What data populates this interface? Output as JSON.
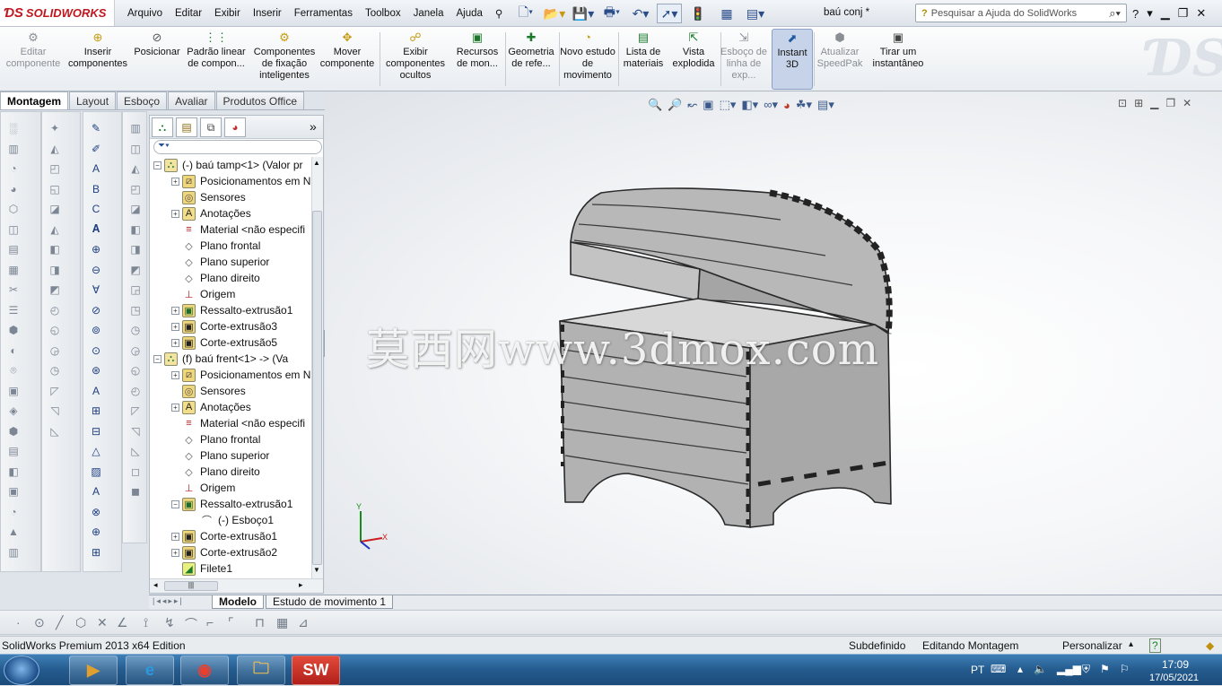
{
  "titlebar": {
    "logo": "SOLIDWORKS",
    "document_title": "baú conj *",
    "search_placeholder": "Pesquisar a Ajuda do SolidWorks",
    "help_mark": "?"
  },
  "menu": [
    "Arquivo",
    "Editar",
    "Exibir",
    "Inserir",
    "Ferramentas",
    "Toolbox",
    "Janela",
    "Ajuda"
  ],
  "command_manager": [
    {
      "label": "Editar componente",
      "state": "disabled"
    },
    {
      "label": "Inserir componentes"
    },
    {
      "label": "Posicionar"
    },
    {
      "label": "Padrão linear de compon..."
    },
    {
      "label": "Componentes de fixação inteligentes"
    },
    {
      "label": "Mover componente"
    },
    {
      "label": "Exibir componentes ocultos"
    },
    {
      "label": "Recursos de mon..."
    },
    {
      "label": "Geometria de refe..."
    },
    {
      "label": "Novo estudo de movimento"
    },
    {
      "label": "Lista de materiais"
    },
    {
      "label": "Vista explodida"
    },
    {
      "label": "Esboço de linha de exp...",
      "state": "disabled"
    },
    {
      "label": "Instant 3D",
      "state": "active"
    },
    {
      "label": "Atualizar SpeedPak",
      "state": "disabled"
    },
    {
      "label": "Tirar um instantâneo"
    }
  ],
  "tabs": [
    "Montagem",
    "Layout",
    "Esboço",
    "Avaliar",
    "Produtos Office"
  ],
  "tree": [
    {
      "level": 0,
      "exp": "-",
      "icon": "assembly-icon",
      "text": "(-) baú tamp<1> (Valor pr"
    },
    {
      "level": 1,
      "exp": "+",
      "icon": "mate-icon",
      "text": "Posicionamentos em N"
    },
    {
      "level": 1,
      "exp": "",
      "icon": "sensor-icon",
      "text": "Sensores"
    },
    {
      "level": 1,
      "exp": "+",
      "icon": "annotation-icon",
      "text": "Anotações"
    },
    {
      "level": 1,
      "exp": "",
      "icon": "material-icon",
      "text": "Material <não especifi"
    },
    {
      "level": 1,
      "exp": "",
      "icon": "plane-icon",
      "text": "Plano frontal"
    },
    {
      "level": 1,
      "exp": "",
      "icon": "plane-icon",
      "text": "Plano superior"
    },
    {
      "level": 1,
      "exp": "",
      "icon": "plane-icon",
      "text": "Plano direito"
    },
    {
      "level": 1,
      "exp": "",
      "icon": "origin-icon",
      "text": "Origem"
    },
    {
      "level": 1,
      "exp": "+",
      "icon": "extrude-icon",
      "text": "Ressalto-extrusão1"
    },
    {
      "level": 1,
      "exp": "+",
      "icon": "cut-icon",
      "text": "Corte-extrusão3"
    },
    {
      "level": 1,
      "exp": "+",
      "icon": "cut-icon",
      "text": "Corte-extrusão5"
    },
    {
      "level": 0,
      "exp": "-",
      "icon": "assembly-icon",
      "text": "(f) baú frent<1> -> (Va"
    },
    {
      "level": 1,
      "exp": "+",
      "icon": "mate-icon",
      "text": "Posicionamentos em N"
    },
    {
      "level": 1,
      "exp": "",
      "icon": "sensor-icon",
      "text": "Sensores"
    },
    {
      "level": 1,
      "exp": "+",
      "icon": "annotation-icon",
      "text": "Anotações"
    },
    {
      "level": 1,
      "exp": "",
      "icon": "material-icon",
      "text": "Material <não especifi"
    },
    {
      "level": 1,
      "exp": "",
      "icon": "plane-icon",
      "text": "Plano frontal"
    },
    {
      "level": 1,
      "exp": "",
      "icon": "plane-icon",
      "text": "Plano superior"
    },
    {
      "level": 1,
      "exp": "",
      "icon": "plane-icon",
      "text": "Plano direito"
    },
    {
      "level": 1,
      "exp": "",
      "icon": "origin-icon",
      "text": "Origem"
    },
    {
      "level": 1,
      "exp": "-",
      "icon": "extrude-icon",
      "text": "Ressalto-extrusão1"
    },
    {
      "level": 2,
      "exp": "",
      "icon": "sketch-icon",
      "text": "(-) Esboço1"
    },
    {
      "level": 1,
      "exp": "+",
      "icon": "cut-icon",
      "text": "Corte-extrusão1"
    },
    {
      "level": 1,
      "exp": "+",
      "icon": "cut-icon",
      "text": "Corte-extrusão2"
    },
    {
      "level": 1,
      "exp": "",
      "icon": "fillet-icon",
      "text": "Filete1"
    }
  ],
  "bottom_tabs": [
    "Modelo",
    "Estudo de movimento 1"
  ],
  "watermark": "莫西网www.3dmox.com",
  "triad": {
    "y": "Y",
    "x": "X"
  },
  "status": {
    "edition": "SolidWorks Premium 2013 x64 Edition",
    "state": "Subdefinido",
    "mode": "Editando Montagem",
    "customize": "Personalizar"
  },
  "taskbar": {
    "language": "PT",
    "time": "17:09",
    "date": "17/05/2021",
    "apps": [
      "media-player",
      "internet-explorer",
      "chrome",
      "file-explorer",
      "solidworks"
    ]
  },
  "colors": {
    "accent": "#1e3f80",
    "taskbar": "#245b8e",
    "model": "#b5b5b5",
    "brand_red": "#c0161e"
  }
}
